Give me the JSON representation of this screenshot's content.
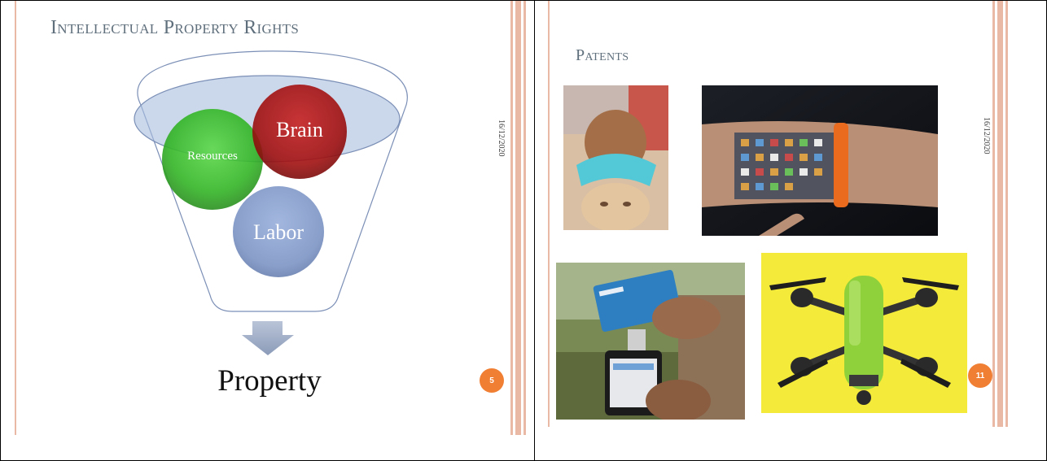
{
  "left_slide": {
    "title": "Intellectual Property Rights",
    "date": "16/12/2020",
    "page_number": "5",
    "diagram": {
      "circles": {
        "resources": "Resources",
        "brain": "Brain",
        "labor": "Labor"
      },
      "output": "Property"
    },
    "colors": {
      "resources": "#3faa2e",
      "brain": "#a31616",
      "labor": "#7f97c6",
      "accent": "#f07f33"
    }
  },
  "right_slide": {
    "title": "Patents",
    "date": "16/12/2020",
    "page_number": "11",
    "images": [
      {
        "name": "child-shampoo-visor-photo"
      },
      {
        "name": "arm-projection-smart-band-photo"
      },
      {
        "name": "phone-card-reader-photo"
      },
      {
        "name": "green-drone-photo"
      }
    ]
  }
}
